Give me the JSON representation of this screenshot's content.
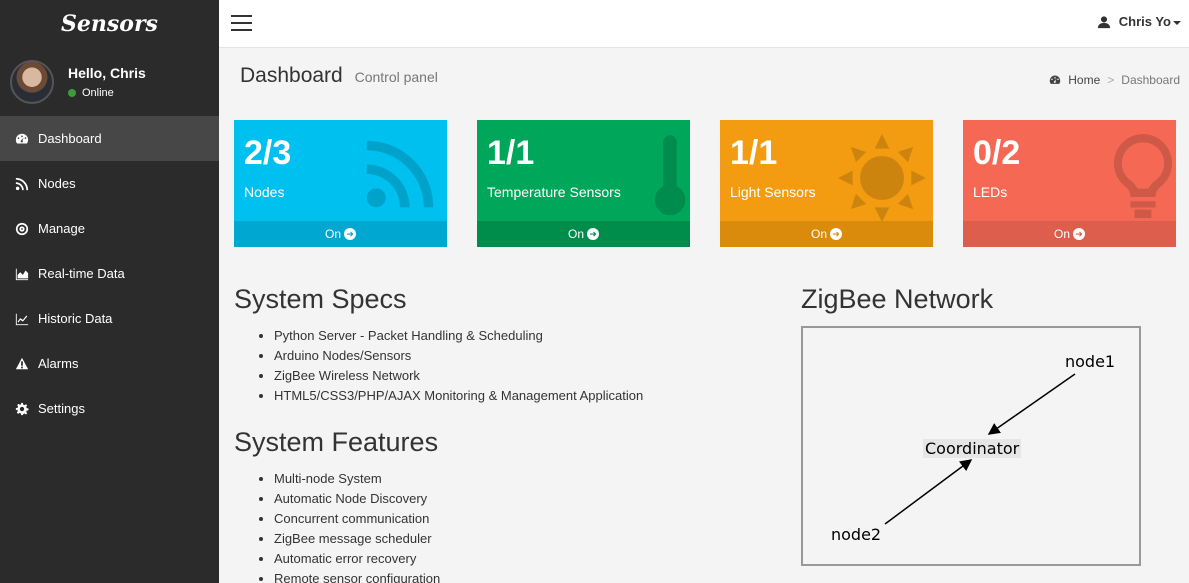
{
  "app": {
    "brand": "Sensors"
  },
  "user_panel": {
    "greeting": "Hello, Chris",
    "status": "Online"
  },
  "sidebar": {
    "items": [
      {
        "label": "Dashboard",
        "icon": "dashboard-icon",
        "active": true
      },
      {
        "label": "Nodes",
        "icon": "rss-icon"
      },
      {
        "label": "Manage",
        "icon": "bullseye-icon"
      },
      {
        "label": "Real-time Data",
        "icon": "area-chart-icon"
      },
      {
        "label": "Historic Data",
        "icon": "line-chart-icon"
      },
      {
        "label": "Alarms",
        "icon": "warning-icon"
      },
      {
        "label": "Settings",
        "icon": "gear-icon"
      }
    ]
  },
  "topbar": {
    "user_name": "Chris Yo"
  },
  "header": {
    "title": "Dashboard",
    "subtitle": "Control panel"
  },
  "breadcrumb": {
    "home": "Home",
    "sep": ">",
    "current": "Dashboard"
  },
  "boxes": [
    {
      "value": "2/3",
      "label": "Nodes",
      "footer": "On",
      "color": "#00c0ef",
      "footer_color": "#00a7d0",
      "icon": "rss-icon"
    },
    {
      "value": "1/1",
      "label": "Temperature Sensors",
      "footer": "On",
      "color": "#00a65a",
      "footer_color": "#008d4c",
      "icon": "thermometer-icon"
    },
    {
      "value": "1/1",
      "label": "Light Sensors",
      "footer": "On",
      "color": "#f39c12",
      "footer_color": "#db8b0b",
      "icon": "sun-icon"
    },
    {
      "value": "0/2",
      "label": "LEDs",
      "footer": "On",
      "color": "#f56954",
      "footer_color": "#dd5e4c",
      "icon": "lightbulb-icon"
    }
  ],
  "specs": {
    "title": "System Specs",
    "items": [
      "Python Server - Packet Handling & Scheduling",
      "Arduino Nodes/Sensors",
      "ZigBee Wireless Network",
      "HTML5/CSS3/PHP/AJAX Monitoring & Management Application"
    ]
  },
  "features": {
    "title": "System Features",
    "items": [
      "Multi-node System",
      "Automatic Node Discovery",
      "Concurrent communication",
      "ZigBee message scheduler",
      "Automatic error recovery",
      "Remote sensor configuration"
    ]
  },
  "network": {
    "title": "ZigBee Network",
    "nodes": {
      "node1": "node1",
      "coordinator": "Coordinator",
      "node2": "node2"
    }
  }
}
